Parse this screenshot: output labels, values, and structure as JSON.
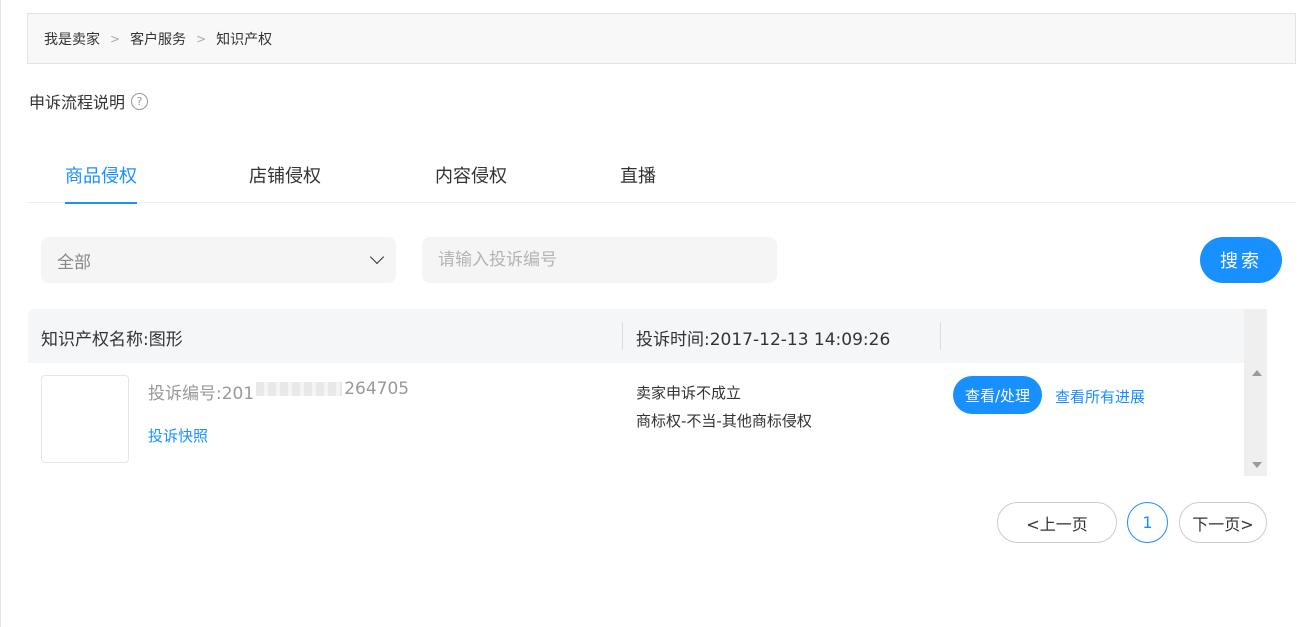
{
  "breadcrumb": {
    "items": [
      "我是卖家",
      "客户服务",
      "知识产权"
    ],
    "separator": ">"
  },
  "process": {
    "title": "申诉流程说明",
    "help_glyph": "?"
  },
  "tabs": [
    {
      "label": "商品侵权",
      "active": true
    },
    {
      "label": "店铺侵权",
      "active": false
    },
    {
      "label": "内容侵权",
      "active": false
    },
    {
      "label": "直播",
      "active": false
    }
  ],
  "filter": {
    "selected": "全部",
    "search_placeholder": "请输入投诉编号",
    "search_label": "搜索"
  },
  "table": {
    "header_name": "知识产权名称:图形",
    "header_time": "投诉时间:2017-12-13 14:09:26",
    "row": {
      "complaint_prefix": "投诉编号:201",
      "complaint_suffix": "264705",
      "snapshot_label": "投诉快照",
      "status_line1": "卖家申诉不成立",
      "status_line2": "商标权-不当-其他商标侵权",
      "view_label": "查看/处理",
      "progress_label": "查看所有进展"
    }
  },
  "pagination": {
    "prev": "<上一页",
    "current": "1",
    "next": "下一页>"
  },
  "colors": {
    "accent": "#1890ff",
    "panel": "#f5f5f5"
  }
}
